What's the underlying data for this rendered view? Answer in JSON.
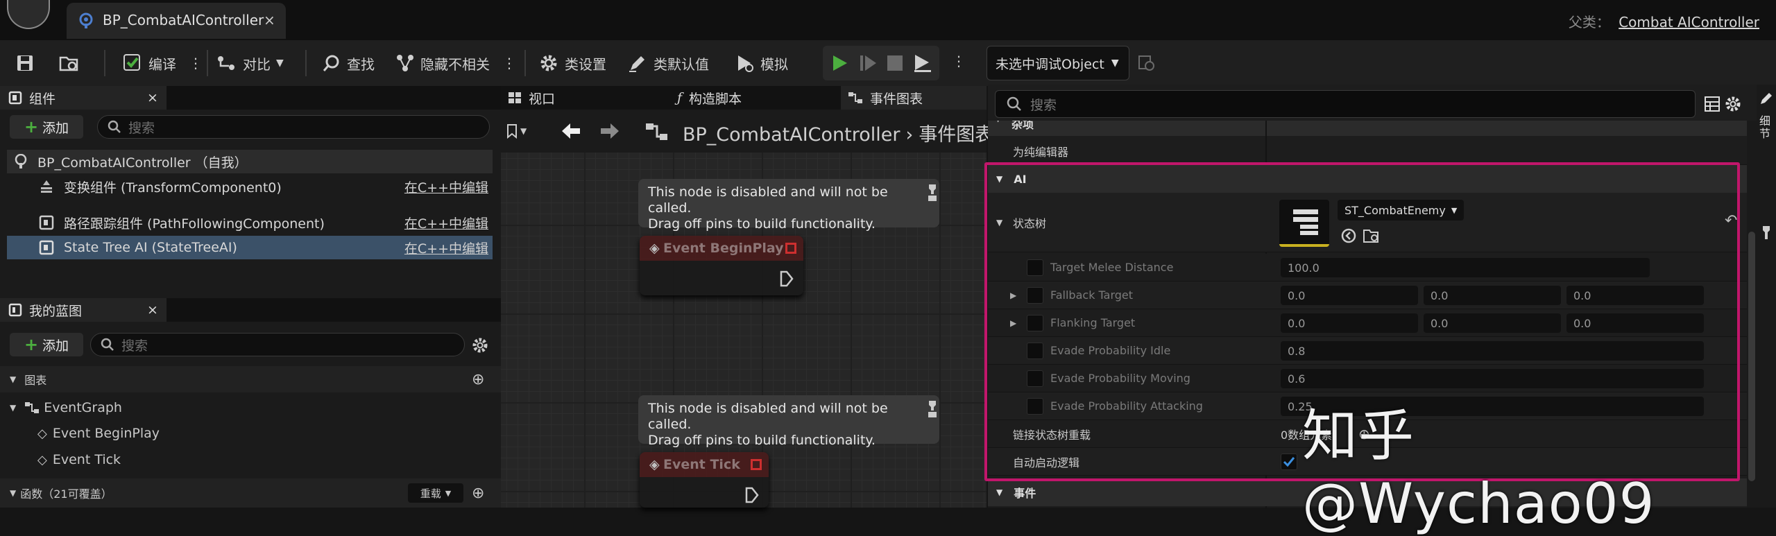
{
  "titlebar": {
    "tab_title": "BP_CombatAIController",
    "close": "×",
    "parent_label": "父类：",
    "parent_value": "Combat AIController"
  },
  "toolbar": {
    "compile": "编译",
    "diff": "对比",
    "find": "查找",
    "hide_unrelated": "隐藏不相关",
    "class_settings": "类设置",
    "class_defaults": "类默认值",
    "simulate": "模拟",
    "debug_object": "未选中调试Object"
  },
  "components": {
    "title": "组件",
    "close": "×",
    "add": "添加",
    "search_placeholder": "搜索",
    "items": [
      {
        "label": "BP_CombatAIController （自我）",
        "edit": ""
      },
      {
        "label": "变换组件 (TransformComponent0)",
        "edit": "在C++中编辑"
      },
      {
        "label": "路径跟踪组件 (PathFollowingComponent)",
        "edit": "在C++中编辑"
      },
      {
        "label": "State Tree AI (StateTreeAI)",
        "edit": "在C++中编辑"
      }
    ]
  },
  "my_blueprint": {
    "title": "我的蓝图",
    "close": "×",
    "add": "添加",
    "search_placeholder": "搜索",
    "graphs": "图表",
    "event_graph": "EventGraph",
    "events": [
      "Event BeginPlay",
      "Event Tick"
    ],
    "functions": "函数（21可覆盖）",
    "override": "重载"
  },
  "graph": {
    "tabs": [
      "视口",
      "构造脚本",
      "事件图表"
    ],
    "breadcrumb": "BP_CombatAIController",
    "breadcrumb_tail": "事件图表",
    "notice_line1": "This node is disabled and will not be called.",
    "notice_line2": "Drag off pins to build functionality.",
    "node1": "Event BeginPlay",
    "node2": "Event Tick"
  },
  "details": {
    "search_placeholder": "搜索",
    "editor_only": "为纯编辑器",
    "cat_ai": "AI",
    "state_tree": "状态树",
    "state_tree_asset": "ST_CombatEnemy",
    "props": [
      {
        "name": "Target Melee Distance",
        "values": [
          "100.0"
        ]
      },
      {
        "name": "Fallback Target",
        "values": [
          "0.0",
          "0.0",
          "0.0"
        ]
      },
      {
        "name": "Flanking Target",
        "values": [
          "0.0",
          "0.0",
          "0.0"
        ]
      },
      {
        "name": "Evade Probability Idle",
        "values": [
          "0.8"
        ]
      },
      {
        "name": "Evade Probability Moving",
        "values": [
          "0.6"
        ]
      },
      {
        "name": "Evade Probability Attacking",
        "values": [
          "0.25"
        ]
      }
    ],
    "link_override": "链接状态树重载",
    "link_value": "0数组元素",
    "auto_start": "自动启动逻辑",
    "cat_events": "事件",
    "cat_top": "杂项"
  },
  "side_tab": "细节",
  "watermark": "知乎 @Wychao09",
  "colors": {
    "accent_blue": "#3b6fb6",
    "highlight": "#c1166b",
    "play_green": "#4caf3f"
  }
}
